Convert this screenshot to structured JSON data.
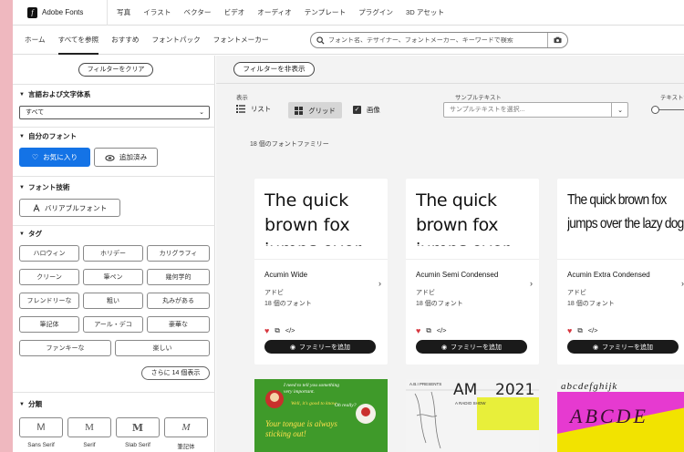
{
  "app": {
    "name": "Adobe Fonts"
  },
  "topnav": [
    "写真",
    "イラスト",
    "ベクター",
    "ビデオ",
    "オーディオ",
    "テンプレート",
    "プラグイン",
    "3D アセット"
  ],
  "subnav": [
    "ホーム",
    "すべてを参照",
    "おすすめ",
    "フォントパック",
    "フォントメーカー"
  ],
  "search": {
    "placeholder": "フォント名、デザイナー、フォントメーカー、キーワードで検索"
  },
  "sidebar": {
    "clear_label": "フィルターをクリア",
    "lang_title": "言語および文字体系",
    "lang_value": "すべて",
    "myfonts_title": "自分のフォント",
    "fav_label": "お気に入り",
    "added_label": "追加済み",
    "tech_title": "フォント技術",
    "variable_label": "バリアブルフォント",
    "tags_title": "タグ",
    "tags": [
      "ハロウィン",
      "ホリデー",
      "カリグラフィ",
      "クリーン",
      "筆ペン",
      "幾何学的",
      "フレンドリーな",
      "粗い",
      "丸みがある",
      "筆記体",
      "アール・デコ",
      "豪華な",
      "ファンキーな",
      "楽しい"
    ],
    "more_label": "さらに 14 個表示",
    "class_title": "分類",
    "classes": [
      {
        "glyph": "M",
        "label": "Sans Serif"
      },
      {
        "glyph": "M",
        "label": "Serif"
      },
      {
        "glyph": "M",
        "label": "Slab Serif"
      },
      {
        "glyph": "M",
        "label": "筆記体"
      }
    ]
  },
  "main": {
    "toggle_label": "フィルターを非表示",
    "display_label": "表示",
    "list_label": "リスト",
    "grid_label": "グリッド",
    "image_label": "画像",
    "sample_title": "サンプルテキスト",
    "sample_placeholder": "サンプルテキストを選択...",
    "size_title": "テキストサイズ",
    "count_text": "18 個のフォントファミリー",
    "cards": [
      {
        "name": "Acumin Wide",
        "maker": "アドビ",
        "count": "18 個のフォント",
        "sample": "The quick brown fox jumps over the lazy dog",
        "add_label": "ファミリーを追加"
      },
      {
        "name": "Acumin Semi Condensed",
        "maker": "アドビ",
        "count": "18 個のフォント",
        "sample": "The quick brown fox jumps over the lazy dog",
        "add_label": "ファミリーを追加"
      },
      {
        "name": "Acumin Extra Condensed",
        "maker": "アドビ",
        "count": "18 個のフォント",
        "sample": "The quick brown fox jumps over the lazy dog",
        "add_label": "ファミリーを追加"
      }
    ],
    "thumbs": [
      {
        "text1": "I need to tell you something very important.",
        "text2": "Well, it's good to know",
        "text3": "Oh really?",
        "text4": "Your tongue is always sticking out!"
      },
      {
        "text1": "A.B.I PRESENTS",
        "title": "AM",
        "year": "2021",
        "sub": "A RADIO SHOW"
      },
      {
        "text1": "abcdefghijk",
        "text2": "ABCDE"
      }
    ]
  },
  "colors": {
    "accent": "#1473e6",
    "heart": "#d7373f",
    "dark": "#1a1a1a"
  }
}
